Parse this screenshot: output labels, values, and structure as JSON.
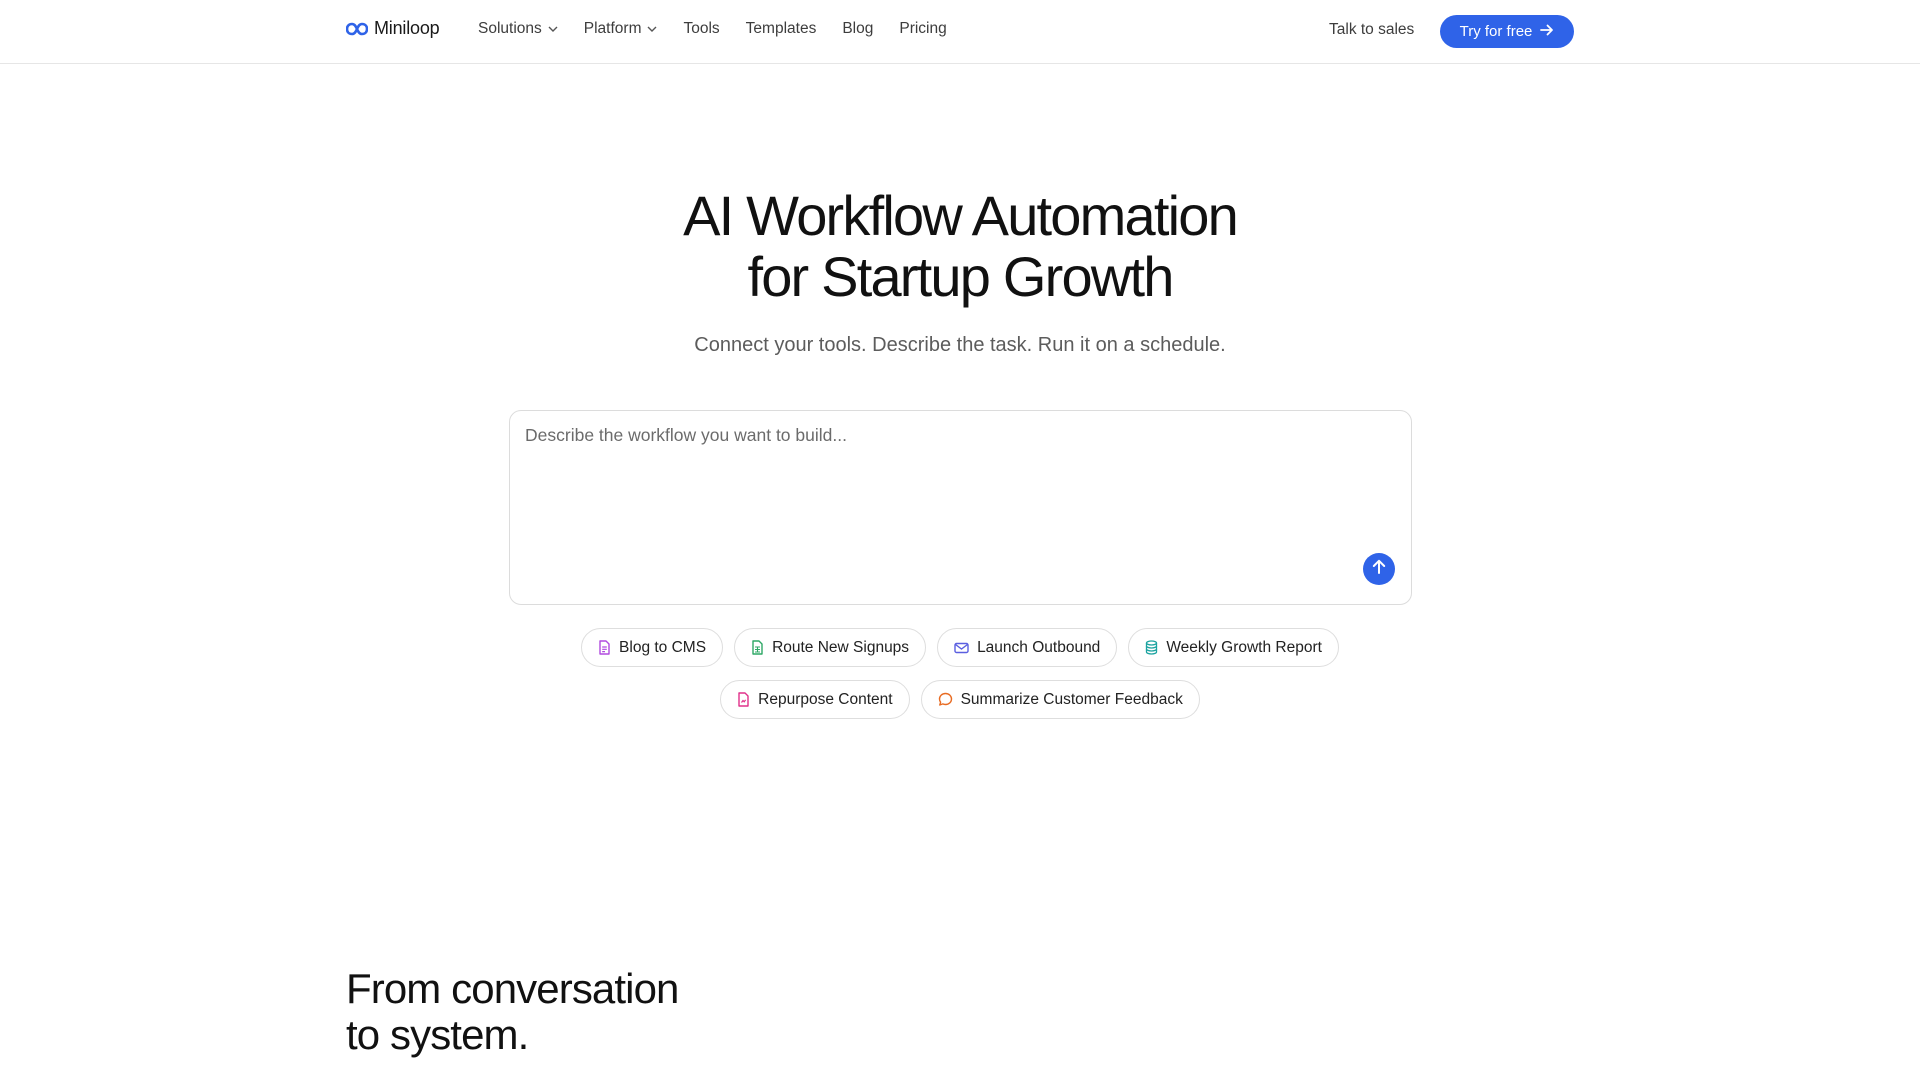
{
  "header": {
    "brand": "Miniloop",
    "nav": [
      {
        "label": "Solutions",
        "dropdown": true
      },
      {
        "label": "Platform",
        "dropdown": true
      },
      {
        "label": "Tools",
        "dropdown": false
      },
      {
        "label": "Templates",
        "dropdown": false
      },
      {
        "label": "Blog",
        "dropdown": false
      },
      {
        "label": "Pricing",
        "dropdown": false
      }
    ],
    "talk_to_sales": "Talk to sales",
    "try_free": "Try for free"
  },
  "hero": {
    "title_line1": "AI Workflow Automation",
    "title_line2": "for Startup Growth",
    "subtitle": "Connect your tools. Describe the task. Run it on a schedule."
  },
  "prompt": {
    "placeholder": "Describe the workflow you want to build...",
    "value": ""
  },
  "chips": [
    {
      "label": "Blog to CMS",
      "icon": "document-icon",
      "color": "#b04adf"
    },
    {
      "label": "Route New Signups",
      "icon": "sheet-icon",
      "color": "#2fa866"
    },
    {
      "label": "Launch Outbound",
      "icon": "mail-icon",
      "color": "#5a5fe0"
    },
    {
      "label": "Weekly Growth Report",
      "icon": "database-icon",
      "color": "#1ba3a0"
    },
    {
      "label": "Repurpose Content",
      "icon": "file-icon",
      "color": "#e0318a"
    },
    {
      "label": "Summarize Customer Feedback",
      "icon": "chat-icon",
      "color": "#e86b22"
    }
  ],
  "section": {
    "title_line1": "From conversation",
    "title_line2": "to system."
  },
  "colors": {
    "accent": "#2f63e8"
  }
}
